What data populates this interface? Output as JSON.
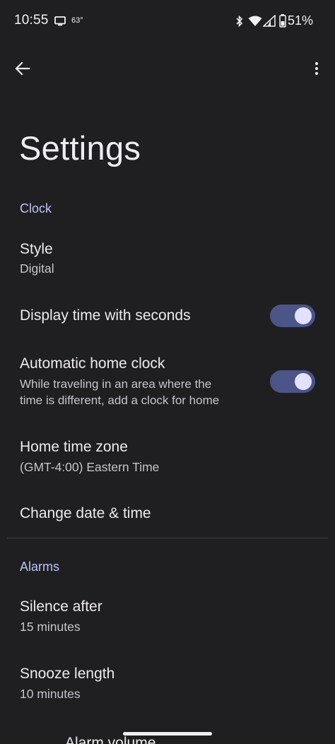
{
  "status_bar": {
    "time": "10:55",
    "temperature": "63°",
    "battery_percent": "51%",
    "icons": [
      "tv-icon",
      "bluetooth-icon",
      "wifi-icon",
      "cell-signal-icon",
      "battery-icon"
    ]
  },
  "app_bar": {
    "back_icon": "arrow-back-icon",
    "more_icon": "more-vert-icon"
  },
  "page_title": "Settings",
  "sections": {
    "clock": {
      "header": "Clock",
      "style": {
        "title": "Style",
        "value": "Digital"
      },
      "display_seconds": {
        "title": "Display time with seconds",
        "enabled": true
      },
      "auto_home_clock": {
        "title": "Automatic home clock",
        "summary_line1": "While traveling in an area where the",
        "summary_line2": "time is different, add a clock for home",
        "enabled": true
      },
      "home_time_zone": {
        "title": "Home time zone",
        "value": "(GMT-4:00) Eastern Time"
      },
      "change_date_time": {
        "title": "Change date & time"
      }
    },
    "alarms": {
      "header": "Alarms",
      "silence_after": {
        "title": "Silence after",
        "value": "15 minutes"
      },
      "snooze_length": {
        "title": "Snooze length",
        "value": "10 minutes"
      },
      "alarm_volume": {
        "title": "Alarm volume"
      }
    }
  },
  "colors": {
    "background": "#1f1f22",
    "accent_header": "#bfc2f8",
    "toggle_track": "#4c5488",
    "toggle_thumb": "#e2e2ff"
  }
}
